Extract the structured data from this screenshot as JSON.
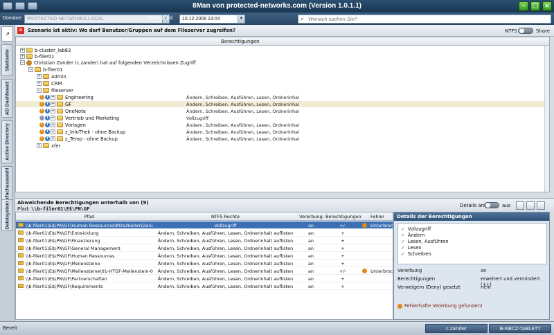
{
  "window": {
    "title": "8Man von protected-networks.com (Version 1.0.1.1)"
  },
  "toolbar": {
    "domain_label": "Domäne:",
    "domain_value": "PROTECTED-NETWORKS.LOCAL",
    "date_label": "Datenstand:",
    "date_value": "10.12.2009 13:04",
    "search_placeholder": "Wonach suchen Sie?"
  },
  "left_tabs": [
    "Startseite",
    "AD Dashboard",
    "Active Directory",
    "Mehrfachauswahl",
    "Dateisystem"
  ],
  "scenario": {
    "text": "Szenario ist aktiv: Wo darf Benutzer/Gruppen auf dem Fileserver zugreifen?",
    "toggle_left": "NTFS",
    "toggle_right": "Share"
  },
  "tree": {
    "column_header": "Berechtigungen",
    "rows": [
      {
        "label": "b-cluster_lab83",
        "perm": ""
      },
      {
        "label": "b-filer01",
        "perm": ""
      },
      {
        "label": "Christian Zander (c.zander) hat auf folgenden Verzeichnissen Zugriff",
        "perm": ""
      },
      {
        "label": "b-filer01",
        "perm": ""
      },
      {
        "label": "Admin",
        "perm": ""
      },
      {
        "label": "CRM",
        "perm": ""
      },
      {
        "label": "fileserver",
        "perm": ""
      },
      {
        "label": "Engineering",
        "perm": "Ändern, Schreiben, Ausführen, Lesen, Ordnerinhal"
      },
      {
        "label": "GF",
        "perm": "Ändern, Schreiben, Ausführen, Lesen, Ordnerinhal"
      },
      {
        "label": "OneNote",
        "perm": "Ändern, Schreiben, Ausführen, Lesen, Ordnerinhal"
      },
      {
        "label": "Vertrieb und Marketing",
        "perm": "Vollzugriff"
      },
      {
        "label": "Vorlagen",
        "perm": "Ändern, Schreiben, Ausführen, Lesen, Ordnerinhal"
      },
      {
        "label": "z_InfoThek - ohne Backup",
        "perm": "Ändern, Schreiben, Ausführen, Lesen, Ordnerinhal"
      },
      {
        "label": "z_Temp - ohne Backup",
        "perm": "Ändern, Schreiben, Ausführen, Lesen, Ordnerinhal"
      },
      {
        "label": "xfer",
        "perm": ""
      }
    ]
  },
  "bottom": {
    "title": "Abweichende Berechtigungen unterhalb von (9)",
    "path_label": "Pfad:",
    "path_value": "\\\\b-filer01\\E$\\PN\\GF",
    "details_toggle_left": "Details an",
    "details_toggle_right": "aus",
    "columns": [
      "Pfad",
      "NTFS Rechte",
      "Vererbung",
      "Berechtigungen",
      "Fehler"
    ],
    "rows": [
      {
        "path": "\\\\b-filer01\\E$\\PN\\GF\\Human Ressources\\Mitarbeiter\\Daniel R",
        "ntfs": "Vollzugriff",
        "inherit": "an",
        "perm": "+/-",
        "err": "Unterbrochene V"
      },
      {
        "path": "\\\\b-filer01\\E$\\PN\\GF\\Entwicklung",
        "ntfs": "Ändern, Schreiben, Ausführen, Lesen, Ordnerinhalt auflisten",
        "inherit": "an",
        "perm": "+",
        "err": ""
      },
      {
        "path": "\\\\b-filer01\\E$\\PN\\GF\\Finanzierung",
        "ntfs": "Ändern, Schreiben, Ausführen, Lesen, Ordnerinhalt auflisten",
        "inherit": "an",
        "perm": "+",
        "err": ""
      },
      {
        "path": "\\\\b-filer01\\E$\\PN\\GF\\General Management",
        "ntfs": "Ändern, Schreiben, Ausführen, Lesen, Ordnerinhalt auflisten",
        "inherit": "an",
        "perm": "+",
        "err": ""
      },
      {
        "path": "\\\\b-filer01\\E$\\PN\\GF\\Human Ressources",
        "ntfs": "Ändern, Schreiben, Ausführen, Lesen, Ordnerinhalt auflisten",
        "inherit": "an",
        "perm": "+",
        "err": ""
      },
      {
        "path": "\\\\b-filer01\\E$\\PN\\GF\\Meilensteine",
        "ntfs": "Ändern, Schreiben, Ausführen, Lesen, Ordnerinhalt auflisten",
        "inherit": "an",
        "perm": "+",
        "err": ""
      },
      {
        "path": "\\\\b-filer01\\E$\\PN\\GF\\Meilensteine\\01-HTGF-Meilenstein-0",
        "ntfs": "Ändern, Schreiben, Ausführen, Lesen, Ordnerinhalt auflisten",
        "inherit": "an",
        "perm": "+/-",
        "err": "Unterbrochene V"
      },
      {
        "path": "\\\\b-filer01\\E$\\PN\\GF\\Partnerschaften",
        "ntfs": "Ändern, Schreiben, Ausführen, Lesen, Ordnerinhalt auflisten",
        "inherit": "an",
        "perm": "+",
        "err": ""
      },
      {
        "path": "\\\\b-filer01\\E$\\PN\\GF\\Requirements",
        "ntfs": "Ändern, Schreiben, Ausführen, Lesen, Ordnerinhalt auflisten",
        "inherit": "an",
        "perm": "+",
        "err": ""
      }
    ]
  },
  "details": {
    "title": "Details der Berechtigungen",
    "perms": [
      "Vollzugriff",
      "Ändern",
      "Lesen, Ausführen",
      "Lesen",
      "Schreiben"
    ],
    "kv": [
      {
        "k": "Vererbung",
        "v": "an"
      },
      {
        "k": "Berechtigungen",
        "v": "erweitert und vermindert (+/-)"
      },
      {
        "k": "Verweigern (Deny) gesetzt",
        "v": "nein"
      }
    ],
    "error": "Fehlerhafte Vererbung gefunden!"
  },
  "status": {
    "ready": "Bereit",
    "user": "c.zander",
    "machine": "B-NBCZ-TABLETT"
  }
}
